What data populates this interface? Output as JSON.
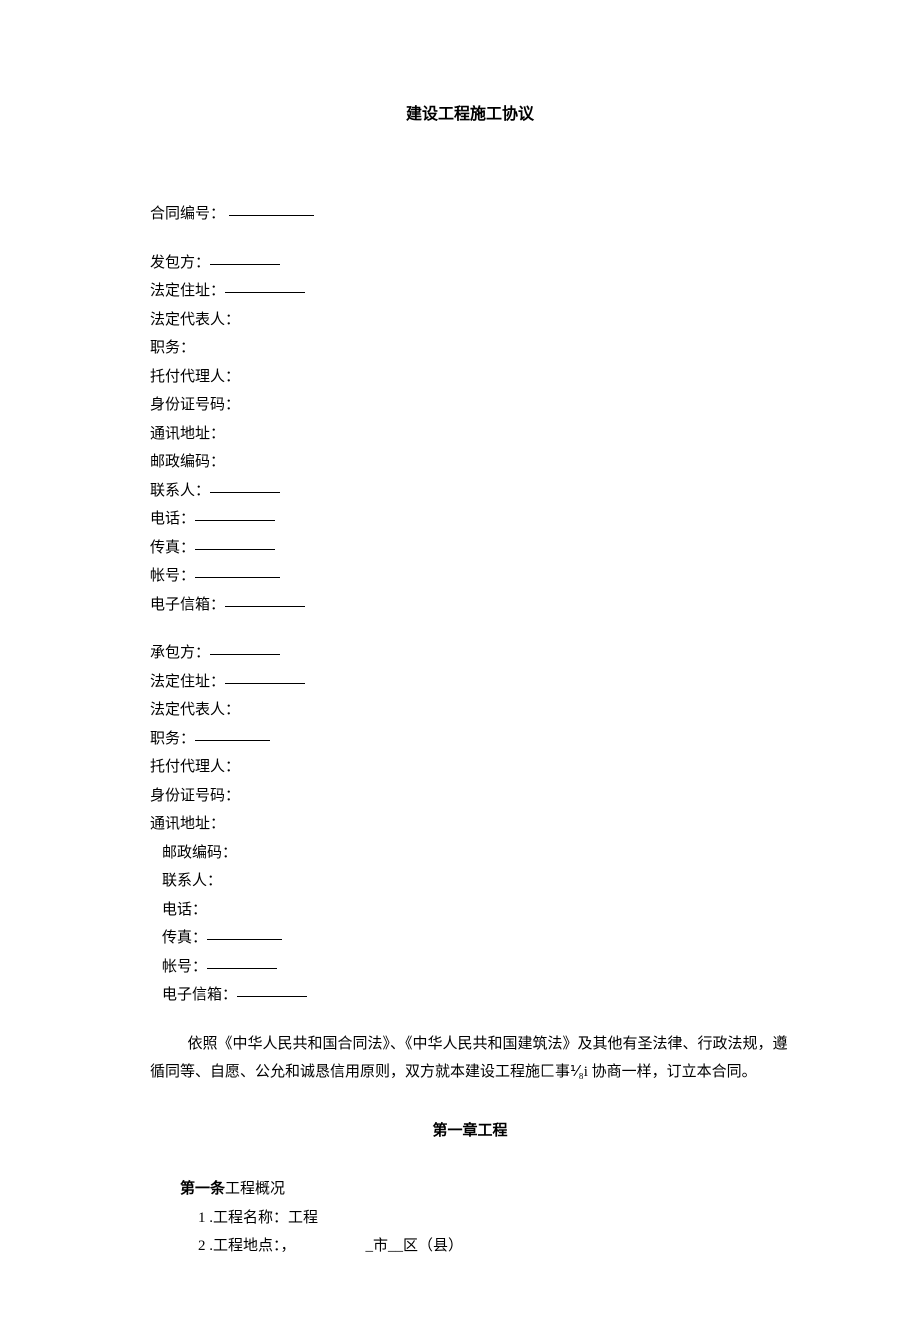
{
  "title": "建设工程施工协议",
  "contract_no_label": "合同编号：",
  "partyA": {
    "header": "发包方：",
    "address_label": "法定住址：",
    "legal_rep_label": "法定代表人：",
    "position_label": "职务：",
    "agent_label": "托付代理人：",
    "id_label": "身份证号码：",
    "mail_addr_label": "通讯地址：",
    "postcode_label": "邮政编码：",
    "contact_label": "联系人：",
    "phone_label": "电话：",
    "fax_label": "传真：",
    "account_label": "帐号：",
    "email_label": "电子信箱："
  },
  "partyB": {
    "header": "承包方：",
    "address_label": "法定住址：",
    "legal_rep_label": "法定代表人：",
    "position_label": "职务：",
    "agent_label": "托付代理人：",
    "id_label": "身份证号码：",
    "mail_addr_label": "通讯地址：",
    "postcode_label": "邮政编码：",
    "contact_label": "联系人：",
    "phone_label": "电话：",
    "fax_label": "传真：",
    "account_label": "帐号：",
    "email_label": "电子信箱："
  },
  "intro": "依照《中华人民共和国合同法》、《中华人民共和国建筑法》及其他有圣法律、行政法规，遵循同等、自愿、公允和诚恳信用原则，双方就本建设工程施匚事⅟₈i 协商一样，订立本合同。",
  "chapter1": "第一章工程",
  "article1": {
    "prefix": "第一条",
    "suffix": "工程概况",
    "item1": "1 .工程名称：工程",
    "item2_a": "2 .工程地点：，",
    "item2_b": "_市__区（县）"
  }
}
